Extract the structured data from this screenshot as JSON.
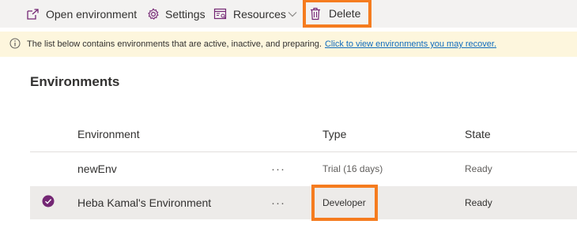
{
  "toolbar": {
    "open_environment_label": "Open environment",
    "settings_label": "Settings",
    "resources_label": "Resources",
    "delete_label": "Delete",
    "icons": {
      "open": "open-in-new-icon",
      "settings": "gear-icon",
      "resources": "resources-icon",
      "chevron": "chevron-down-icon",
      "delete": "trash-icon"
    },
    "accent_color": "#742774",
    "highlight_color": "#f57c1f"
  },
  "banner": {
    "icon": "info-icon",
    "message": "The list below contains environments that are active, inactive, and preparing.",
    "link_text": "Click to view environments you may recover."
  },
  "page": {
    "title": "Environments"
  },
  "table": {
    "columns": {
      "environment": "Environment",
      "type": "Type",
      "state": "State"
    },
    "rows": [
      {
        "name": "newEnv",
        "more": "···",
        "type": "Trial (16 days)",
        "state": "Ready",
        "selected": false
      },
      {
        "name": "Heba Kamal's Environment",
        "more": "···",
        "type": "Developer",
        "state": "Ready",
        "selected": true
      }
    ]
  }
}
